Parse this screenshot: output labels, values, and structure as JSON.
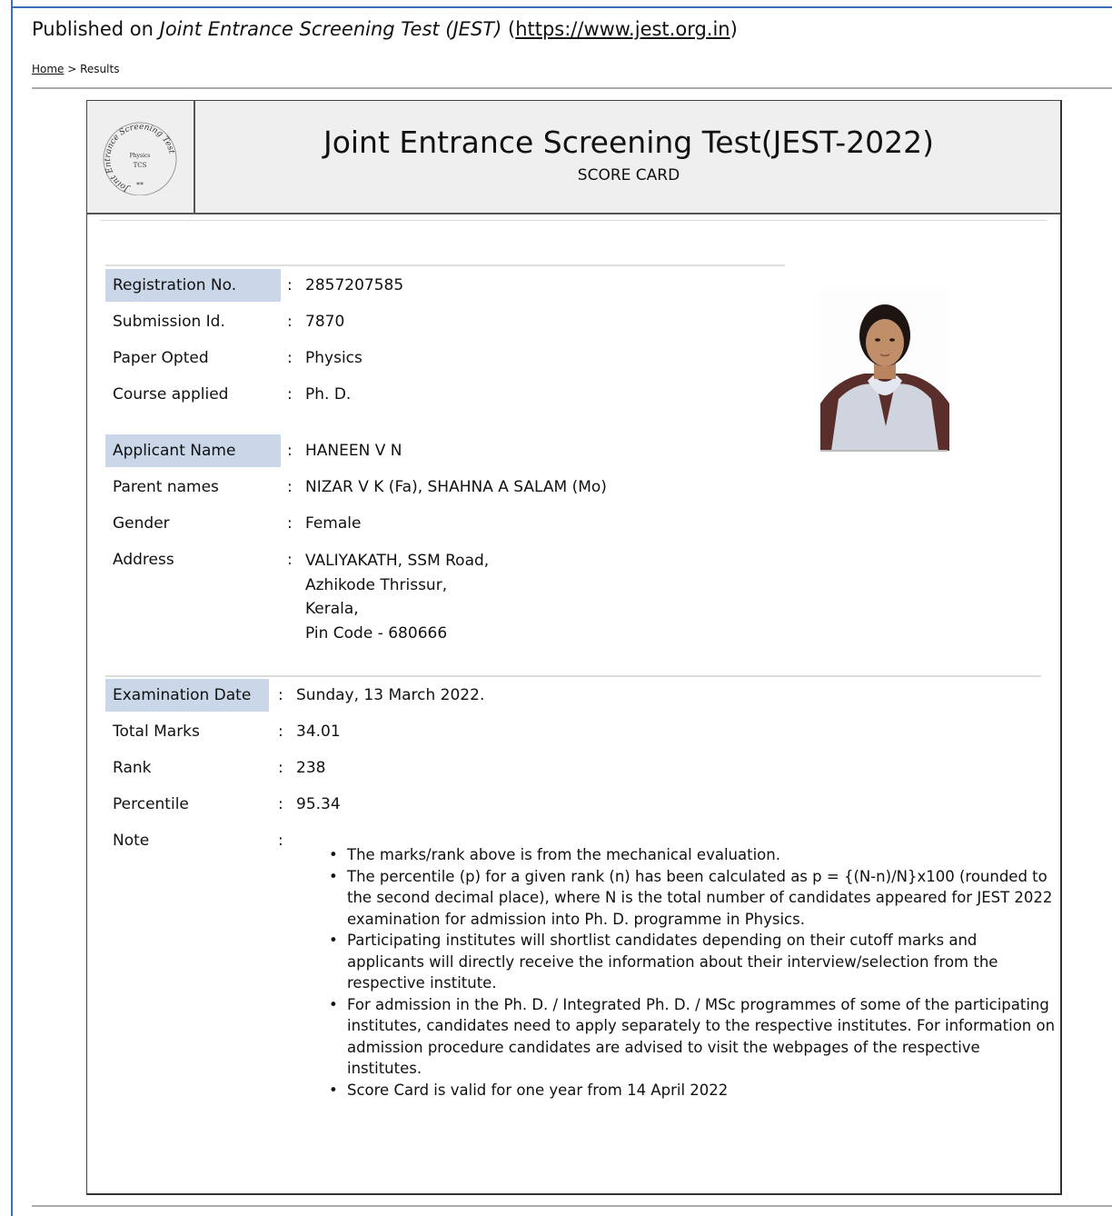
{
  "header": {
    "published_prefix": "Published on ",
    "site_name": "Joint Entrance Screening Test (JEST)",
    "url_open": " (",
    "url": "https://www.jest.org.in",
    "url_close": ")"
  },
  "breadcrumb": {
    "home": "Home",
    "sep": " > ",
    "current": "Results"
  },
  "logo": {
    "ring_text": "Joint Entrance Screening Test",
    "inner_line1": "Physics",
    "inner_line2": "TCS",
    "stars": "**"
  },
  "scorecard": {
    "title": "Joint Entrance Screening Test(JEST-2022)",
    "subtitle": "SCORE CARD"
  },
  "colon": ":",
  "registration": [
    {
      "label": "Registration No.",
      "value": "2857207585"
    },
    {
      "label": "Submission Id.",
      "value": "7870"
    },
    {
      "label": "Paper Opted",
      "value": "Physics"
    },
    {
      "label": "Course applied",
      "value": "Ph. D."
    }
  ],
  "applicant": [
    {
      "label": "Applicant Name",
      "value": "HANEEN V N"
    },
    {
      "label": "Parent names",
      "value": "NIZAR V K (Fa), SHAHNA A SALAM (Mo)"
    },
    {
      "label": "Gender",
      "value": "Female"
    },
    {
      "label": "Address"
    }
  ],
  "address_lines": [
    "VALIYAKATH, SSM Road,",
    "Azhikode Thrissur,",
    "Kerala,",
    "Pin Code - 680666"
  ],
  "exam": [
    {
      "label": "Examination Date",
      "value": "Sunday, 13 March 2022."
    },
    {
      "label": "Total Marks",
      "value": "34.01"
    },
    {
      "label": "Rank",
      "value": "238"
    },
    {
      "label": "Percentile",
      "value": "95.34"
    },
    {
      "label": "Note"
    }
  ],
  "notes": [
    "The marks/rank above is from the mechanical evaluation.",
    "The percentile (p) for a given rank (n) has been calculated as p = {(N-n)/N}x100 (rounded to the second decimal place), where N is the total number of candidates appeared for JEST 2022 examination for admission into Ph. D. programme in Physics.",
    "Participating institutes will shortlist candidates depending on their cutoff marks and applicants will directly receive the information about their interview/selection from the respective institute.",
    "For admission in the Ph. D. / Integrated Ph. D. / MSc programmes of some of the participating institutes, candidates need to apply separately to the respective institutes. For information on admission procedure candidates are advised to visit the webpages of the respective institutes.",
    "Score Card is valid for one year from 14 April 2022"
  ]
}
